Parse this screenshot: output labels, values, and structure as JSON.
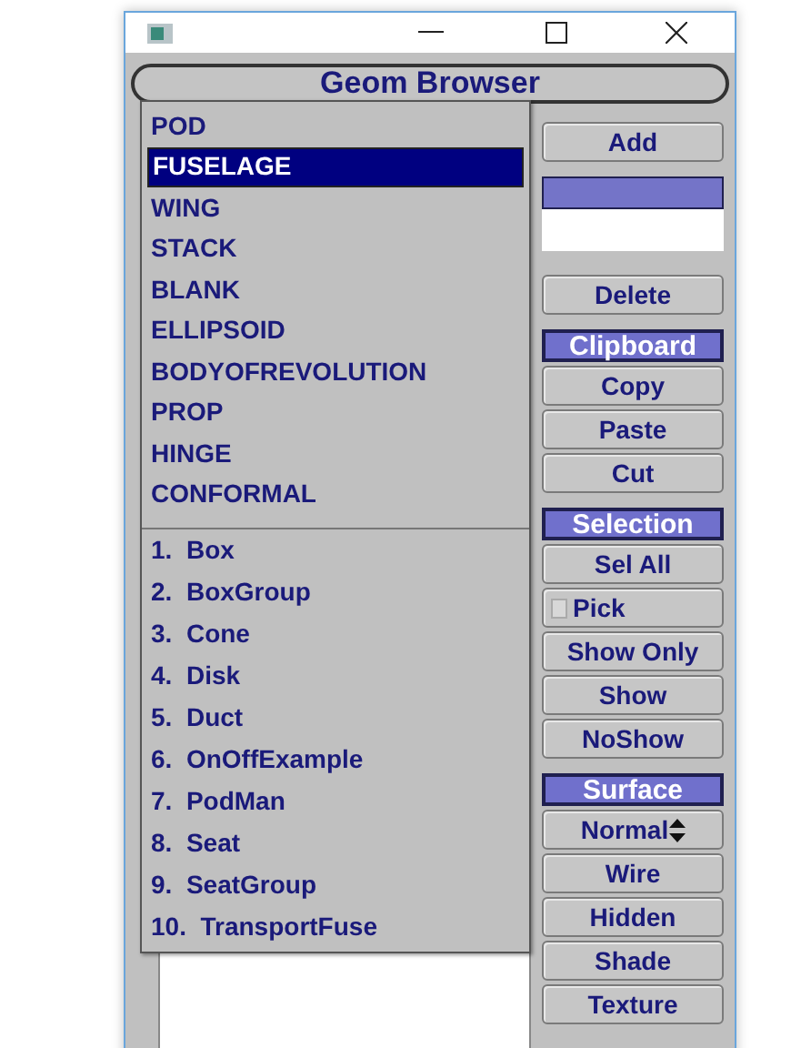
{
  "window": {
    "title": "Geom Browser"
  },
  "type_menu": [
    {
      "label": "POD",
      "selected": false
    },
    {
      "label": "FUSELAGE",
      "selected": true
    },
    {
      "label": "WING",
      "selected": false
    },
    {
      "label": "STACK",
      "selected": false
    },
    {
      "label": "BLANK",
      "selected": false
    },
    {
      "label": "ELLIPSOID",
      "selected": false
    },
    {
      "label": "BODYOFREVOLUTION",
      "selected": false
    },
    {
      "label": "PROP",
      "selected": false
    },
    {
      "label": "HINGE",
      "selected": false
    },
    {
      "label": "CONFORMAL",
      "selected": false
    }
  ],
  "custom_menu": [
    {
      "label": "1.  Box"
    },
    {
      "label": "2.  BoxGroup"
    },
    {
      "label": "3.  Cone"
    },
    {
      "label": "4.  Disk"
    },
    {
      "label": "5.  Duct"
    },
    {
      "label": "6.  OnOffExample"
    },
    {
      "label": "7.  PodMan"
    },
    {
      "label": "8.  Seat"
    },
    {
      "label": "9.  SeatGroup"
    },
    {
      "label": "10.  TransportFuse"
    }
  ],
  "side_panel": [
    {
      "kind": "button",
      "label": "Add"
    },
    {
      "kind": "swatch"
    },
    {
      "kind": "field"
    },
    {
      "kind": "button",
      "label": "Delete"
    },
    {
      "kind": "header",
      "label": "Clipboard"
    },
    {
      "kind": "button",
      "label": "Copy"
    },
    {
      "kind": "button",
      "label": "Paste"
    },
    {
      "kind": "button",
      "label": "Cut"
    },
    {
      "kind": "header",
      "label": "Selection"
    },
    {
      "kind": "button",
      "label": "Sel All"
    },
    {
      "kind": "checkbox",
      "label": "Pick",
      "checked": false
    },
    {
      "kind": "button",
      "label": "Show Only"
    },
    {
      "kind": "button",
      "label": "Show"
    },
    {
      "kind": "button",
      "label": "NoShow"
    },
    {
      "kind": "header",
      "label": "Surface"
    },
    {
      "kind": "select",
      "label": "Normal"
    },
    {
      "kind": "button",
      "label": "Wire"
    },
    {
      "kind": "button",
      "label": "Hidden"
    },
    {
      "kind": "button",
      "label": "Shade"
    },
    {
      "kind": "button",
      "label": "Texture"
    }
  ]
}
